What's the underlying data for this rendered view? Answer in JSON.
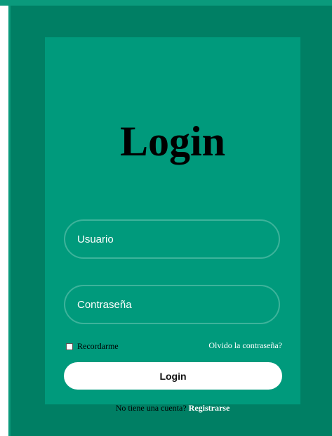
{
  "colors": {
    "outer_background": "#007f64",
    "card_background": "#009a7c",
    "stripe": "#0a9a7c",
    "field_border": "#3db39b",
    "button_background": "#ffffff"
  },
  "login": {
    "title": "Login",
    "username_placeholder": "Usuario",
    "password_placeholder": "Contraseña",
    "remember_label": "Recordarme",
    "forgot_link": "Olvido la contraseña?",
    "submit_label": "Login",
    "register_prompt": "No tiene una cuenta?",
    "register_link": "Registrarse"
  }
}
